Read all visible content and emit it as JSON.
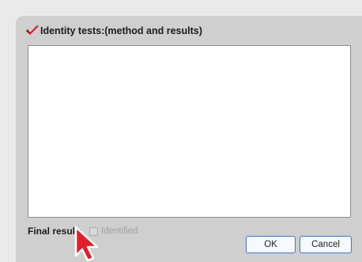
{
  "dialog": {
    "title": "Identity tests:(method and results)",
    "header_icon": "red-checkmark-icon",
    "text_area_value": ""
  },
  "final_result": {
    "label": "Final result:",
    "checkbox_label": "Identified",
    "checked": false
  },
  "buttons": {
    "ok_label": "OK",
    "cancel_label": "Cancel"
  },
  "colors": {
    "dialog_background": "#cfcfcf",
    "button_border": "#3d78c9",
    "icon_red": "#d0202a",
    "cursor_red": "#e0202a"
  }
}
